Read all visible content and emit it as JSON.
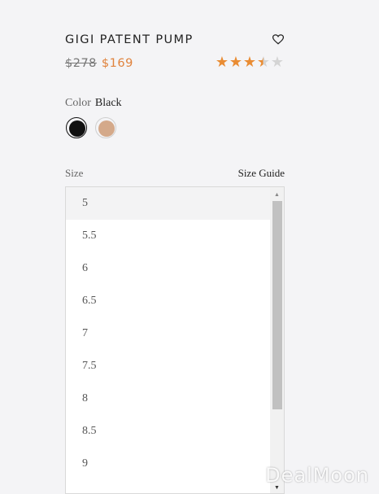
{
  "product": {
    "name": "GIGI PATENT PUMP",
    "price_original": "$278",
    "price_sale": "$169",
    "rating": 3.5,
    "rating_max": 5
  },
  "color": {
    "label": "Color",
    "selected": "Black",
    "swatches": [
      {
        "name": "Black",
        "hex": "#111111",
        "selected": true
      },
      {
        "name": "Nude",
        "hex": "#d4a98a",
        "selected": false
      }
    ]
  },
  "size": {
    "label": "Size",
    "guide_label": "Size Guide",
    "options": [
      "5",
      "5.5",
      "6",
      "6.5",
      "7",
      "7.5",
      "8",
      "8.5",
      "9"
    ],
    "highlighted": "5"
  },
  "icons": {
    "favorite": "heart-icon",
    "rating": "star-icon",
    "scroll_up": "triangle-up-icon",
    "scroll_down": "triangle-down-icon"
  },
  "colors": {
    "accent": "#e0833d",
    "star": "#e98c33"
  },
  "watermark": "DealMoon"
}
